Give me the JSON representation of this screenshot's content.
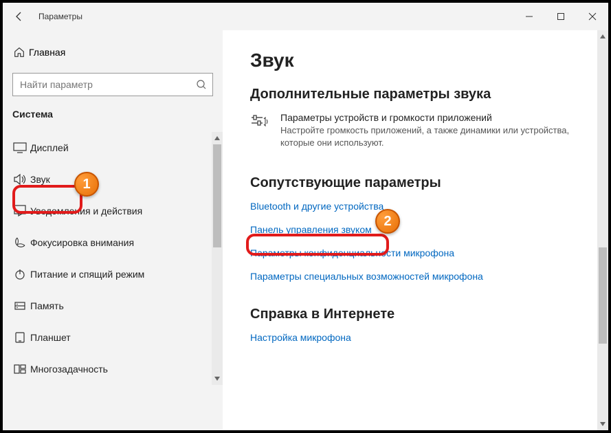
{
  "window": {
    "title": "Параметры"
  },
  "sidebar": {
    "home_label": "Главная",
    "search_placeholder": "Найти параметр",
    "section_label": "Система",
    "items": [
      {
        "label": "Дисплей"
      },
      {
        "label": "Звук"
      },
      {
        "label": "Уведомления и действия"
      },
      {
        "label": "Фокусировка внимания"
      },
      {
        "label": "Питание и спящий режим"
      },
      {
        "label": "Память"
      },
      {
        "label": "Планшет"
      },
      {
        "label": "Многозадачность"
      }
    ]
  },
  "main": {
    "heading": "Звук",
    "adv_heading": "Дополнительные параметры звука",
    "adv_item": {
      "title": "Параметры устройств и громкости приложений",
      "desc": "Настройте громкость приложений, а также динамики или устройства, которые они используют."
    },
    "related_heading": "Сопутствующие параметры",
    "links": [
      "Bluetooth и другие устройства",
      "Панель управления звуком",
      "Параметры конфиденциальности микрофона",
      "Параметры специальных возможностей микрофона"
    ],
    "help_heading": "Справка в Интернете",
    "help_link": "Настройка микрофона"
  },
  "annotations": {
    "num1": "1",
    "num2": "2"
  }
}
